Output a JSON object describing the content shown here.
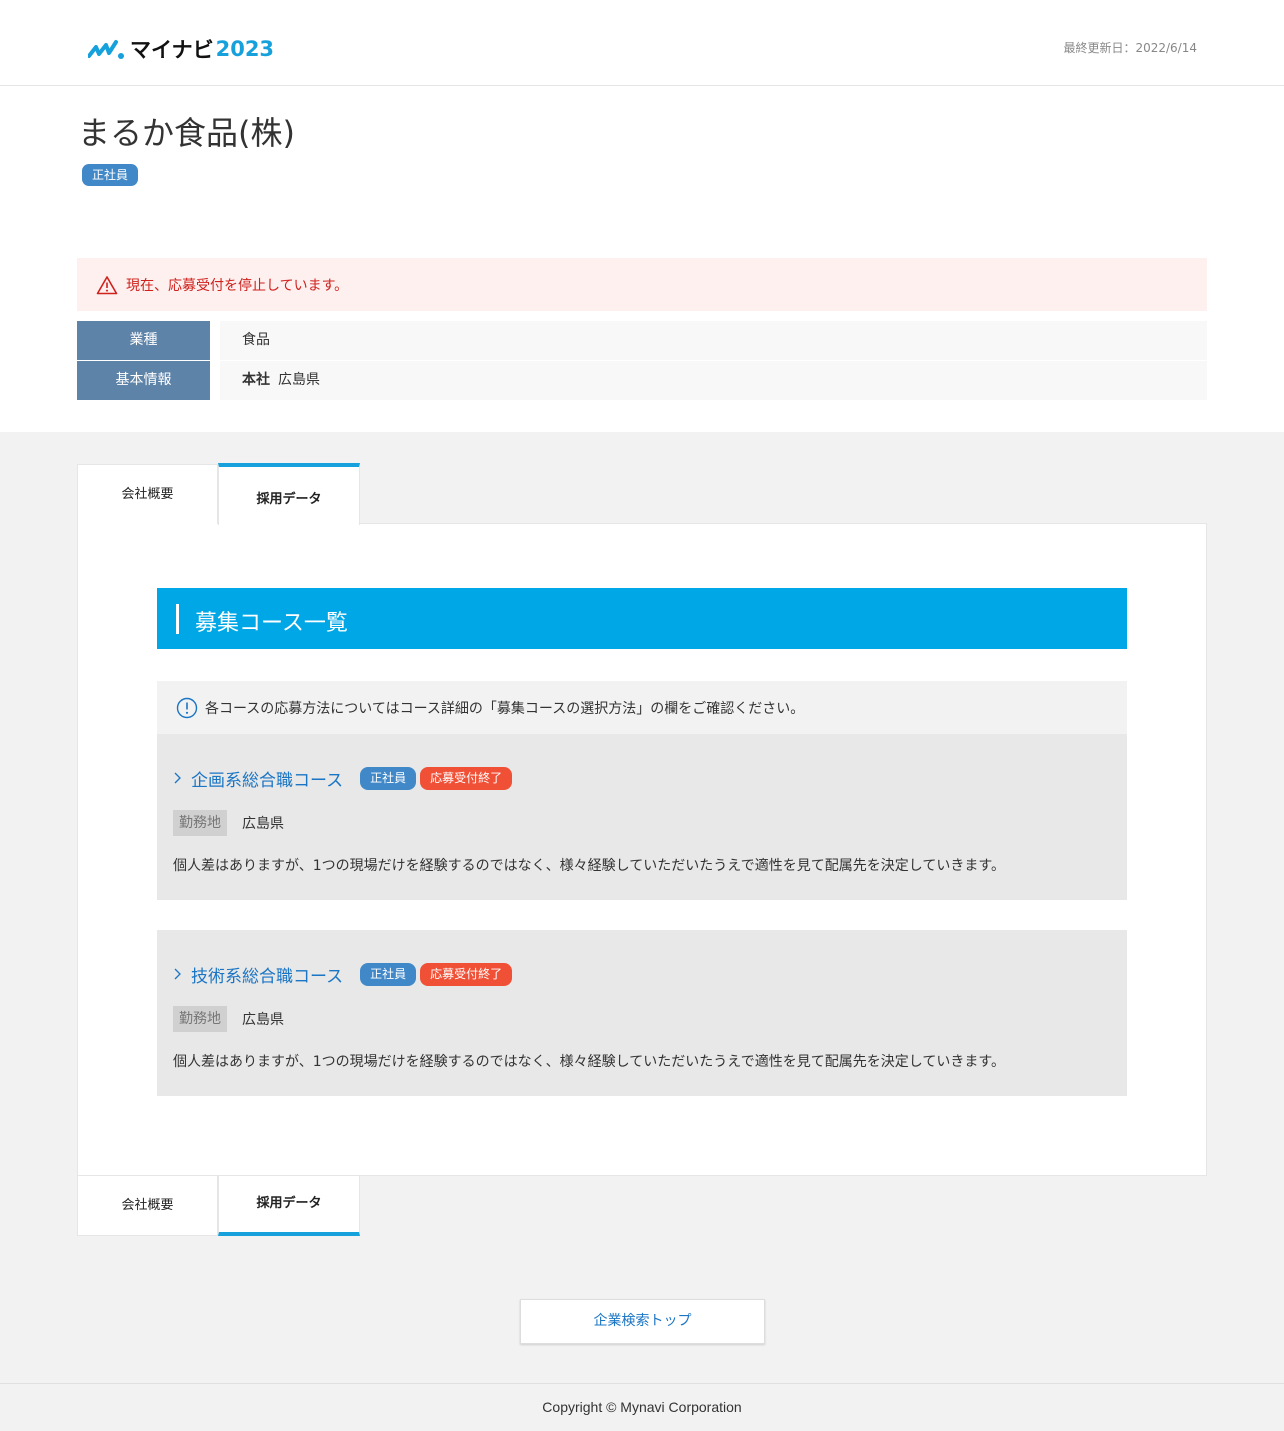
{
  "header": {
    "logo_name": "マイナビ",
    "logo_year": "2023",
    "last_updated": "最終更新日：2022/6/14"
  },
  "company": {
    "name": "まるか食品(株)",
    "employment_badge": "正社員"
  },
  "alert": {
    "text": "現在、応募受付を停止しています。"
  },
  "info": [
    {
      "key": "業種",
      "value": "食品"
    },
    {
      "key": "基本情報",
      "label": "本社",
      "value": "広島県"
    }
  ],
  "tabs": {
    "overview": "会社概要",
    "recruit_data": "採用データ"
  },
  "section": {
    "title": "募集コース一覧",
    "notice": "各コースの応募方法についてはコース詳細の「募集コースの選択方法」の欄をご確認ください。"
  },
  "courses": [
    {
      "title": "企画系総合職コース",
      "badge_type": "正社員",
      "badge_status": "応募受付終了",
      "location_label": "勤務地",
      "location": "広島県",
      "description": "個人差はありますが、1つの現場だけを経験するのではなく、様々経験していただいたうえで適性を見て配属先を決定していきます。"
    },
    {
      "title": "技術系総合職コース",
      "badge_type": "正社員",
      "badge_status": "応募受付終了",
      "location_label": "勤務地",
      "location": "広島県",
      "description": "個人差はありますが、1つの現場だけを経験するのではなく、様々経験していただいたうえで適性を見て配属先を決定していきます。"
    }
  ],
  "search_top_button": "企業検索トップ",
  "footer": {
    "copyright": "Copyright © Mynavi Corporation"
  },
  "colors": {
    "accent": "#00a7e6",
    "badge_blue": "#4088c8",
    "badge_red": "#f05036",
    "alert_red": "#d0211c",
    "link": "#1a75c4"
  },
  "icons": [
    "mynavi-logo-icon",
    "warning-icon",
    "info-icon",
    "chevron-right-icon"
  ]
}
